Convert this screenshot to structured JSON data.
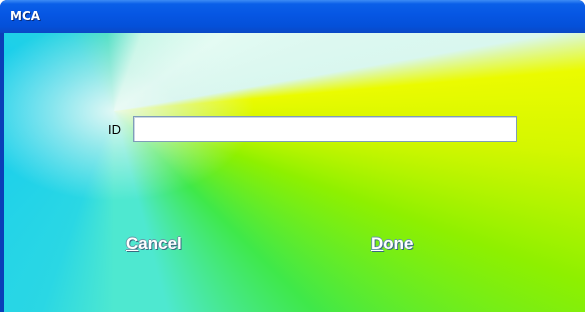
{
  "window": {
    "title": "MCA"
  },
  "form": {
    "id_label": "ID",
    "id_value": ""
  },
  "buttons": {
    "cancel": {
      "mnemonic": "C",
      "rest": "ancel"
    },
    "done": {
      "mnemonic": "D",
      "rest": "one"
    }
  }
}
